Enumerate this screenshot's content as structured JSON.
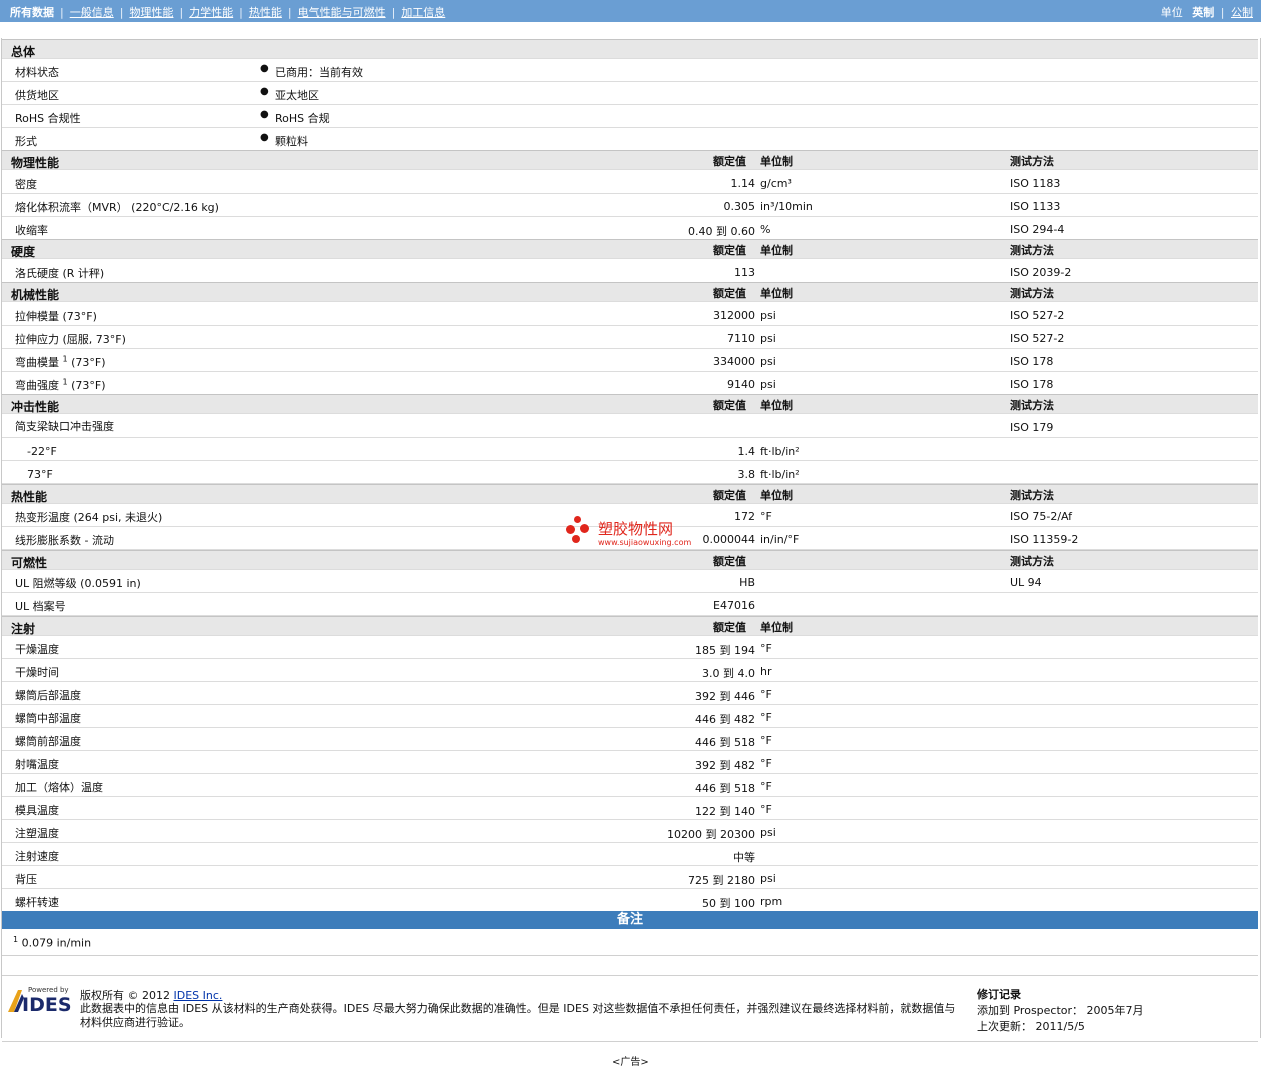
{
  "nav": {
    "tabs": [
      "所有数据",
      "一般信息",
      "物理性能",
      "力学性能",
      "热性能",
      "电气性能与可燃性",
      "加工信息"
    ],
    "units_label": "单位",
    "unit_current": "英制",
    "unit_alt": "公制"
  },
  "general": {
    "title": "总体",
    "rows": [
      {
        "label": "材料状态",
        "value": "已商用：当前有效"
      },
      {
        "label": "供货地区",
        "value": "亚太地区"
      },
      {
        "label": "RoHS 合规性",
        "value": "RoHS 合规"
      },
      {
        "label": "形式",
        "value": "颗粒料"
      }
    ]
  },
  "headers": {
    "value": "额定值",
    "unit": "单位制",
    "test": "测试方法"
  },
  "sections": {
    "physical": {
      "title": "物理性能",
      "rows": [
        {
          "label": "密度",
          "value": "1.14",
          "unit": "g/cm³",
          "test": "ISO 1183"
        },
        {
          "label": "熔化体积流率（MVR） (220°C/2.16 kg)",
          "value": "0.305",
          "unit": "in³/10min",
          "test": "ISO 1133"
        },
        {
          "label": "收缩率",
          "value": "0.40 到  0.60",
          "unit": "%",
          "test": "ISO 294-4"
        }
      ]
    },
    "hardness": {
      "title": "硬度",
      "rows": [
        {
          "label": "洛氏硬度 (R 计秤)",
          "value": "113",
          "unit": "",
          "test": "ISO 2039-2"
        }
      ]
    },
    "mechanical": {
      "title": "机械性能",
      "rows": [
        {
          "label": "拉伸模量 (73°F)",
          "value": "312000",
          "unit": "psi",
          "test": "ISO 527-2"
        },
        {
          "label": "拉伸应力 (屈服, 73°F)",
          "value": "7110",
          "unit": "psi",
          "test": "ISO 527-2"
        },
        {
          "label": "弯曲模量",
          "sup": "1",
          "label2": "(73°F)",
          "value": "334000",
          "unit": "psi",
          "test": "ISO 178"
        },
        {
          "label": "弯曲强度",
          "sup": "1",
          "label2": "(73°F)",
          "value": "9140",
          "unit": "psi",
          "test": "ISO 178"
        }
      ]
    },
    "impact": {
      "title": "冲击性能",
      "rows": [
        {
          "label": "简支梁缺口冲击强度",
          "value": "",
          "unit": "",
          "test": "ISO 179"
        },
        {
          "label": "-22°F",
          "value": "1.4",
          "unit": "ft·lb/in²",
          "test": ""
        },
        {
          "label": "73°F",
          "value": "3.8",
          "unit": "ft·lb/in²",
          "test": ""
        }
      ]
    },
    "thermal": {
      "title": "热性能",
      "rows": [
        {
          "label": "热变形温度 (264 psi, 未退火)",
          "value": "172",
          "unit": "°F",
          "test": "ISO 75-2/Af"
        },
        {
          "label": "线形膨胀系数 - 流动",
          "value": "0.000044",
          "unit": "in/in/°F",
          "test": "ISO 11359-2"
        }
      ]
    },
    "flammability": {
      "title": "可燃性",
      "rows": [
        {
          "label": "UL 阻燃等级 (0.0591 in)",
          "value": "HB",
          "unit": "",
          "test": "UL 94"
        },
        {
          "label": "UL 档案号",
          "value": "E47016",
          "unit": "",
          "test": ""
        }
      ]
    },
    "injection": {
      "title": "注射",
      "rows": [
        {
          "label": "干燥温度",
          "value": "185 到  194",
          "unit": "°F"
        },
        {
          "label": "干燥时间",
          "value": "3.0 到  4.0",
          "unit": "hr"
        },
        {
          "label": "螺筒后部温度",
          "value": "392 到  446",
          "unit": "°F"
        },
        {
          "label": "螺筒中部温度",
          "value": "446 到  482",
          "unit": "°F"
        },
        {
          "label": "螺筒前部温度",
          "value": "446 到  518",
          "unit": "°F"
        },
        {
          "label": "射嘴温度",
          "value": "392 到  482",
          "unit": "°F"
        },
        {
          "label": "加工（熔体）温度",
          "value": "446 到  518",
          "unit": "°F"
        },
        {
          "label": "模具温度",
          "value": "122 到  140",
          "unit": "°F"
        },
        {
          "label": "注塑温度",
          "value": "10200 到  20300",
          "unit": "psi"
        },
        {
          "label": "注射速度",
          "value": "中等",
          "unit": ""
        },
        {
          "label": "背压",
          "value": "725 到  2180",
          "unit": "psi"
        },
        {
          "label": "螺杆转速",
          "value": "50 到  100",
          "unit": "rpm"
        }
      ]
    }
  },
  "notes": {
    "title": "备注",
    "items": [
      {
        "sup": "1",
        "text": "0.079 in/min"
      }
    ]
  },
  "watermark": {
    "text": "塑胶物性网",
    "url": "www.sujiaowuxing.com"
  },
  "footer": {
    "logo_powered": "Powered by",
    "logo_name": "IDES",
    "copyright_prefix": "版权所有 © 2012",
    "copyright_link": "IDES Inc.",
    "disclaimer": "此数据表中的信息由 IDES 从该材料的生产商处获得。IDES 尽最大努力确保此数据的准确性。但是 IDES 对这些数据值不承担任何责任，并强烈建议在最终选择材料前，就数据值与材料供应商进行验证。",
    "revision_title": "修订记录",
    "added": "添加到 Prospector： 2005年7月",
    "updated": "上次更新： 2011/5/5",
    "ad": "<广告>"
  },
  "colors": {
    "nav_bg": "#6a9ed3",
    "notes_bg": "#3d7dbb",
    "section_bg": "#e7e7e7",
    "watermark": "#e0261c"
  }
}
